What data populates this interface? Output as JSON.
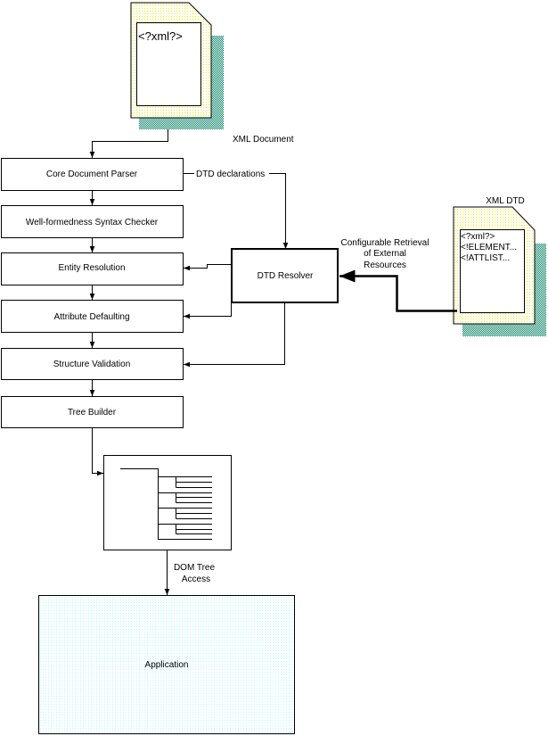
{
  "documents": {
    "xml_document": {
      "label": "XML Document",
      "content": "<?xml?>"
    },
    "xml_dtd": {
      "label": "XML DTD",
      "lines": [
        "<?xml?>",
        "<!ELEMENT...",
        "<!ATTLIST..."
      ]
    }
  },
  "pipeline": [
    {
      "label": "Core Document Parser"
    },
    {
      "label": "Well-formedness Syntax Checker"
    },
    {
      "label": "Entity Resolution"
    },
    {
      "label": "Attribute Defaulting"
    },
    {
      "label": "Structure Validation"
    },
    {
      "label": "Tree Builder"
    }
  ],
  "dtd_resolver": {
    "label": "DTD Resolver"
  },
  "edges": {
    "dtd_declarations": "DTD declarations",
    "retrieval": [
      "Configurable Retrieval",
      "of External",
      "Resources"
    ],
    "dom_access": [
      "DOM Tree",
      "Access"
    ]
  },
  "application": {
    "label": "Application"
  },
  "colors": {
    "page_dots": "#ffff00",
    "shadow": "#007f5f",
    "app_dots": "#b0ffff"
  }
}
